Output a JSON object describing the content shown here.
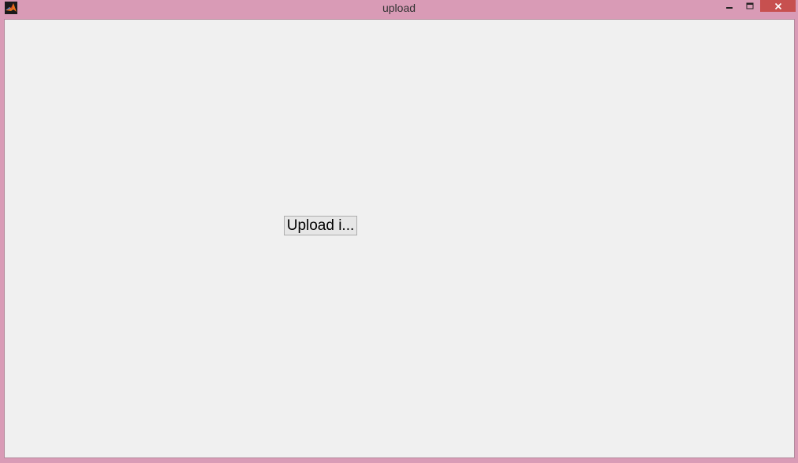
{
  "window": {
    "title": "upload",
    "app_icon": "matlab-logo-icon",
    "controls": {
      "minimize_icon": "minimize-icon",
      "maximize_icon": "maximize-icon",
      "close_icon": "close-icon"
    }
  },
  "main": {
    "upload_button_label": "Upload i..."
  },
  "colors": {
    "frame": "#d99bb6",
    "close_button": "#c7504f",
    "client_background": "#f0f0f0"
  }
}
